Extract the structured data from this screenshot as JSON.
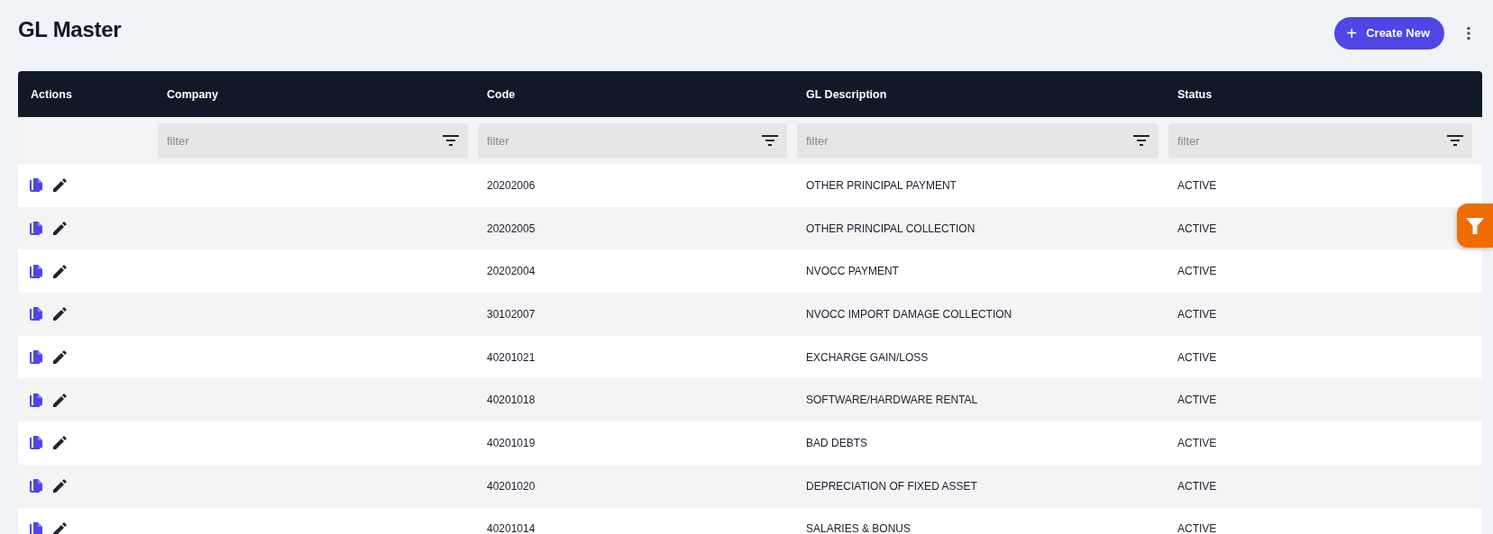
{
  "page": {
    "title": "GL Master"
  },
  "toolbar": {
    "create_button": {
      "icon": "+",
      "label": "Create New"
    }
  },
  "table": {
    "columns": [
      "Actions",
      "Company",
      "Code",
      "GL Description",
      "Status"
    ],
    "filters": [
      {
        "placeholder": "filter"
      },
      {
        "placeholder": "filter"
      },
      {
        "placeholder": "filter"
      },
      {
        "placeholder": "filter"
      }
    ],
    "rows": [
      {
        "code": "20202006",
        "description": "OTHER PRINCIPAL PAYMENT",
        "status": "ACTIVE"
      },
      {
        "code": "20202005",
        "description": "OTHER PRINCIPAL COLLECTION",
        "status": "ACTIVE"
      },
      {
        "code": "20202004",
        "description": "NVOCC PAYMENT",
        "status": "ACTIVE"
      },
      {
        "code": "30102007",
        "description": "NVOCC IMPORT DAMAGE COLLECTION",
        "status": "ACTIVE"
      },
      {
        "code": "40201021",
        "description": "EXCHARGE GAIN/LOSS",
        "status": "ACTIVE"
      },
      {
        "code": "40201018",
        "description": "SOFTWARE/HARDWARE RENTAL",
        "status": "ACTIVE"
      },
      {
        "code": "40201019",
        "description": "BAD DEBTS",
        "status": "ACTIVE"
      },
      {
        "code": "40201020",
        "description": "DEPRECIATION OF FIXED ASSET",
        "status": "ACTIVE"
      },
      {
        "code": "40201014",
        "description": "SALARIES & BONUS",
        "status": "ACTIVE"
      }
    ]
  }
}
